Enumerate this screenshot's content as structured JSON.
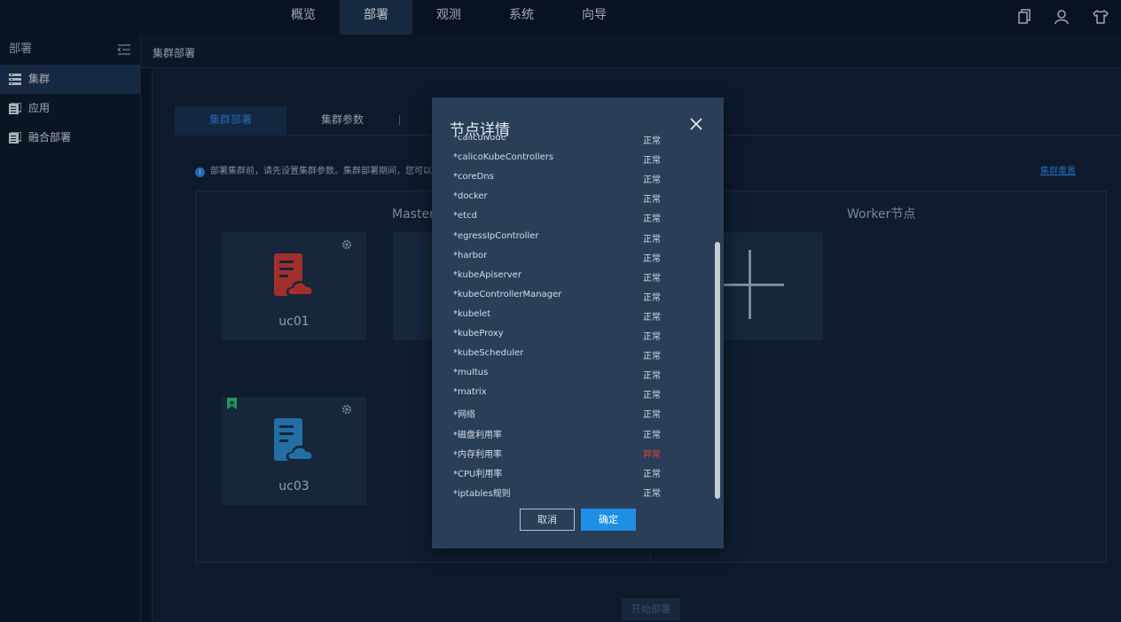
{
  "topnav": {
    "tabs": [
      "概览",
      "部署",
      "观测",
      "系统",
      "向导"
    ],
    "active_tab": "部署",
    "icons": [
      "copy-icon",
      "user-icon",
      "shirt-icon"
    ]
  },
  "sidebar": {
    "title": "部署",
    "items": [
      {
        "label": "集群",
        "icon": "cluster-list-icon",
        "active": true
      },
      {
        "label": "应用",
        "icon": "app-icon",
        "active": false
      },
      {
        "label": "融合部署",
        "icon": "fusion-deploy-icon",
        "active": false
      }
    ]
  },
  "breadcrumb": "集群部署",
  "subtabs": [
    "集群部署",
    "集群参数"
  ],
  "notice": "部署集群前，请先设置集群参数。集群部署期间，您可以点",
  "reset_link": "集群重置",
  "columns": {
    "master": "Master节点",
    "worker": "Worker节点"
  },
  "nodes": [
    {
      "name": "uc01",
      "color": "#d93b34"
    },
    {
      "name": "uc03",
      "color": "#2e8fd6"
    }
  ],
  "deploy_button": "开始部署",
  "modal": {
    "title": "节点详情",
    "rows": [
      {
        "k": "*calicoNode",
        "v": "正常"
      },
      {
        "k": "*calicoKubeControllers",
        "v": "正常"
      },
      {
        "k": "*coreDns",
        "v": "正常"
      },
      {
        "k": "*docker",
        "v": "正常"
      },
      {
        "k": "*etcd",
        "v": "正常"
      },
      {
        "k": "*egressIpController",
        "v": "正常"
      },
      {
        "k": "*harbor",
        "v": "正常"
      },
      {
        "k": "*kubeApiserver",
        "v": "正常"
      },
      {
        "k": "*kubeControllerManager",
        "v": "正常"
      },
      {
        "k": "*kubelet",
        "v": "正常"
      },
      {
        "k": "*kubeProxy",
        "v": "正常"
      },
      {
        "k": "*kubeScheduler",
        "v": "正常"
      },
      {
        "k": "*multus",
        "v": "正常"
      },
      {
        "k": "*matrix",
        "v": "正常"
      },
      {
        "k": "*网络",
        "v": "正常"
      },
      {
        "k": "*磁盘利用率",
        "v": "正常"
      },
      {
        "k": "*内存利用率",
        "v": "异常"
      },
      {
        "k": "*CPU利用率",
        "v": "正常"
      },
      {
        "k": "*iptables规则",
        "v": "正常"
      }
    ],
    "cancel_label": "取消",
    "ok_label": "确定",
    "colors": {
      "normal": "#d4dce7",
      "abnormal": "#e0452f",
      "primary": "#1f8fe6"
    }
  }
}
